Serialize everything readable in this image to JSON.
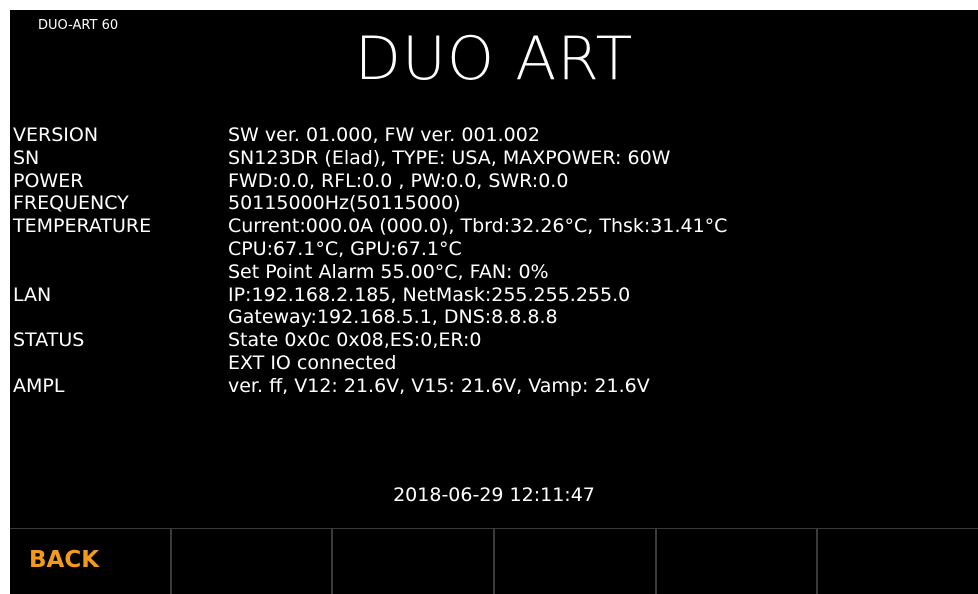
{
  "header": {
    "model": "DUO-ART 60",
    "title": "DUO ART"
  },
  "info_rows": [
    {
      "label": "VERSION",
      "value": "SW ver. 01.000, FW ver. 001.002"
    },
    {
      "label": "SN",
      "value": "SN123DR (Elad), TYPE: USA, MAXPOWER: 60W"
    },
    {
      "label": "POWER",
      "value": "FWD:0.0, RFL:0.0 , PW:0.0, SWR:0.0"
    },
    {
      "label": "FREQUENCY",
      "value": "50115000Hz(50115000)"
    },
    {
      "label": "TEMPERATURE",
      "value": "Current:000.0A (000.0), Tbrd:32.26°C, Thsk:31.41°C"
    },
    {
      "label": "",
      "value": "CPU:67.1°C, GPU:67.1°C"
    },
    {
      "label": "",
      "value": "Set Point Alarm 55.00°C, FAN: 0%"
    },
    {
      "label": "LAN",
      "value": "IP:192.168.2.185, NetMask:255.255.255.0"
    },
    {
      "label": "",
      "value": "Gateway:192.168.5.1, DNS:8.8.8.8"
    },
    {
      "label": "STATUS",
      "value": "State 0x0c 0x08,ES:0,ER:0"
    },
    {
      "label": "",
      "value": "EXT IO connected"
    },
    {
      "label": "AMPL",
      "value": "ver. ff, V12: 21.6V, V15: 21.6V, Vamp: 21.6V"
    }
  ],
  "datetime": "2018-06-29 12:11:47",
  "softkeys": [
    {
      "label": "BACK"
    },
    {
      "label": ""
    },
    {
      "label": ""
    },
    {
      "label": ""
    },
    {
      "label": ""
    },
    {
      "label": ""
    }
  ],
  "colors": {
    "background": "#000000",
    "text": "#ffffff",
    "accent": "#f39a1c"
  }
}
